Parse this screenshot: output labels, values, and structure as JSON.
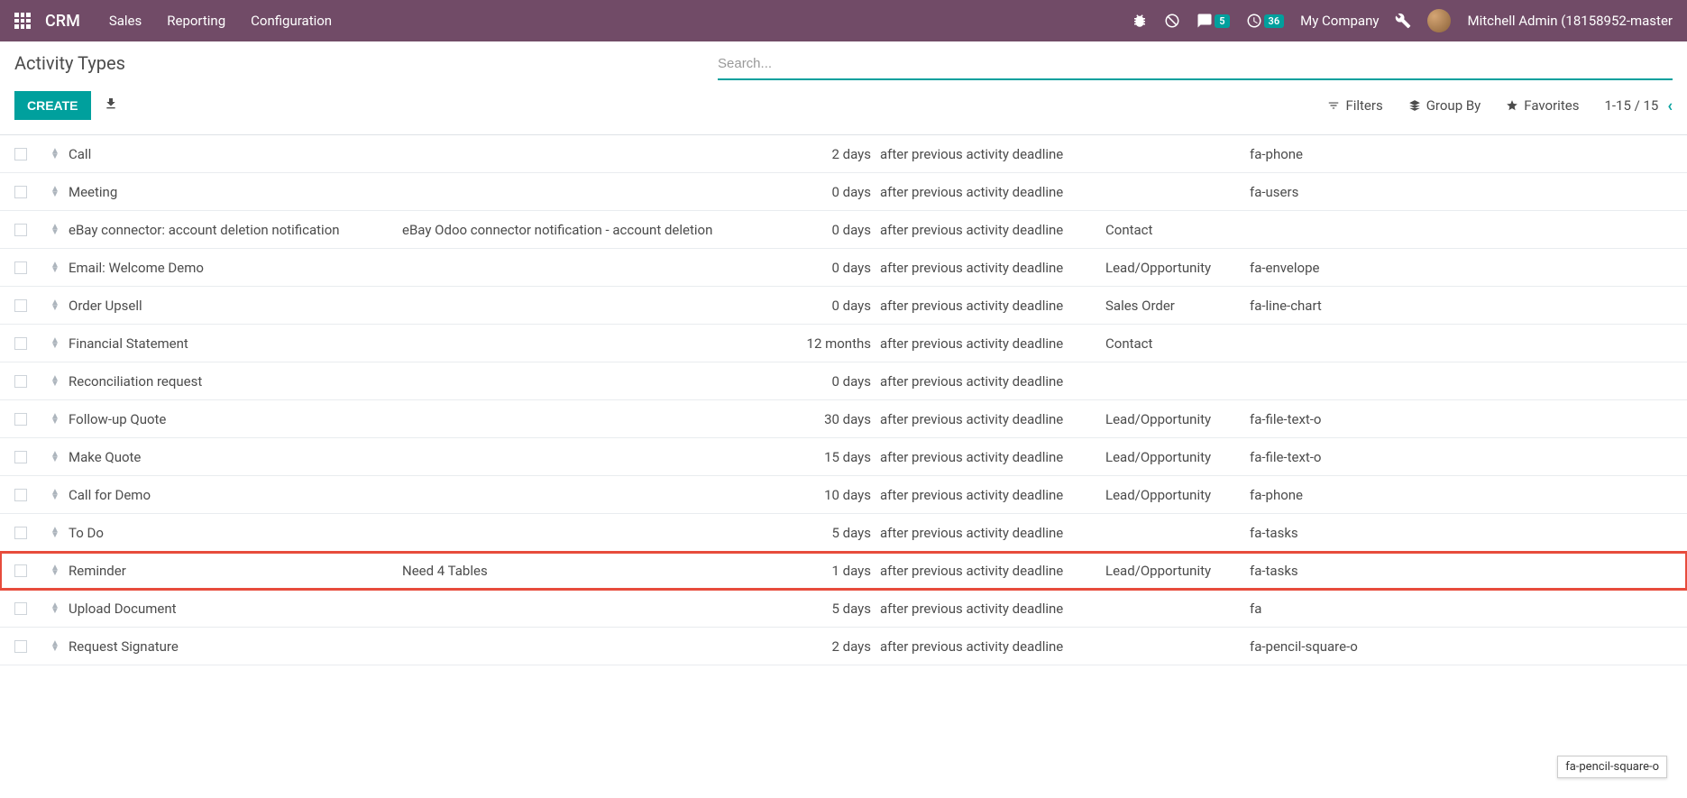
{
  "navbar": {
    "brand": "CRM",
    "menu": [
      "Sales",
      "Reporting",
      "Configuration"
    ],
    "messages_badge": "5",
    "activities_badge": "36",
    "company": "My Company",
    "user": "Mitchell Admin (18158952-master"
  },
  "control_panel": {
    "title": "Activity Types",
    "search_placeholder": "Search...",
    "create_label": "Create",
    "filters_label": "Filters",
    "groupby_label": "Group By",
    "favorites_label": "Favorites",
    "pager_text": "1-15 / 15"
  },
  "rows": [
    {
      "name": "Call",
      "summary": "",
      "delay": "2 days",
      "delay_from": "after previous activity deadline",
      "model": "",
      "icon": "fa-phone",
      "highlight": false
    },
    {
      "name": "Meeting",
      "summary": "",
      "delay": "0 days",
      "delay_from": "after previous activity deadline",
      "model": "",
      "icon": "fa-users",
      "highlight": false
    },
    {
      "name": "eBay connector: account deletion notification",
      "summary": "eBay Odoo connector notification - account deletion",
      "delay": "0 days",
      "delay_from": "after previous activity deadline",
      "model": "Contact",
      "icon": "",
      "highlight": false
    },
    {
      "name": "Email: Welcome Demo",
      "summary": "",
      "delay": "0 days",
      "delay_from": "after previous activity deadline",
      "model": "Lead/Opportunity",
      "icon": "fa-envelope",
      "highlight": false
    },
    {
      "name": "Order Upsell",
      "summary": "",
      "delay": "0 days",
      "delay_from": "after previous activity deadline",
      "model": "Sales Order",
      "icon": "fa-line-chart",
      "highlight": false
    },
    {
      "name": "Financial Statement",
      "summary": "",
      "delay": "12 months",
      "delay_from": "after previous activity deadline",
      "model": "Contact",
      "icon": "",
      "highlight": false
    },
    {
      "name": "Reconciliation request",
      "summary": "",
      "delay": "0 days",
      "delay_from": "after previous activity deadline",
      "model": "",
      "icon": "",
      "highlight": false
    },
    {
      "name": "Follow-up Quote",
      "summary": "",
      "delay": "30 days",
      "delay_from": "after previous activity deadline",
      "model": "Lead/Opportunity",
      "icon": "fa-file-text-o",
      "highlight": false
    },
    {
      "name": "Make Quote",
      "summary": "",
      "delay": "15 days",
      "delay_from": "after previous activity deadline",
      "model": "Lead/Opportunity",
      "icon": "fa-file-text-o",
      "highlight": false
    },
    {
      "name": "Call for Demo",
      "summary": "",
      "delay": "10 days",
      "delay_from": "after previous activity deadline",
      "model": "Lead/Opportunity",
      "icon": "fa-phone",
      "highlight": false
    },
    {
      "name": "To Do",
      "summary": "",
      "delay": "5 days",
      "delay_from": "after previous activity deadline",
      "model": "",
      "icon": "fa-tasks",
      "highlight": false
    },
    {
      "name": "Reminder",
      "summary": "Need 4 Tables",
      "delay": "1 days",
      "delay_from": "after previous activity deadline",
      "model": "Lead/Opportunity",
      "icon": "fa-tasks",
      "highlight": true
    },
    {
      "name": "Upload Document",
      "summary": "",
      "delay": "5 days",
      "delay_from": "after previous activity deadline",
      "model": "",
      "icon": "fa",
      "highlight": false
    },
    {
      "name": "Request Signature",
      "summary": "",
      "delay": "2 days",
      "delay_from": "after previous activity deadline",
      "model": "",
      "icon": "fa-pencil-square-o",
      "highlight": false
    }
  ],
  "tooltip": "fa-pencil-square-o"
}
